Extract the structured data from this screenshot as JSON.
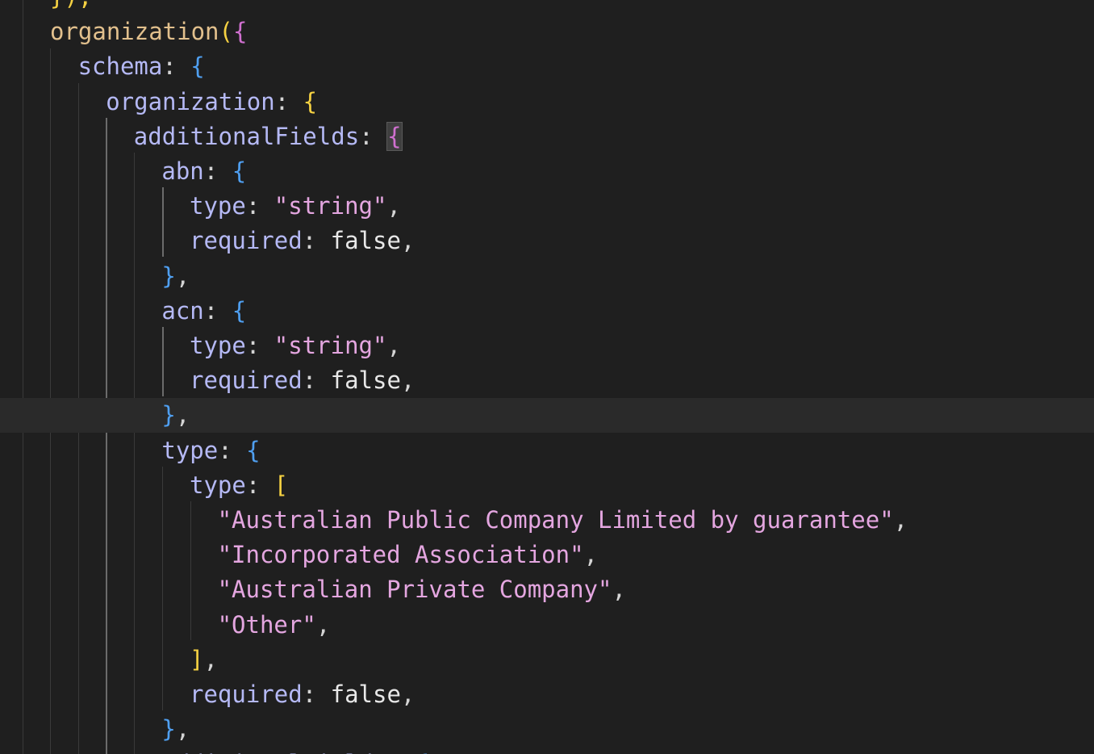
{
  "editor": {
    "lines": [
      {
        "tokens": [
          {
            "t": "});",
            "c": "b-yellow"
          }
        ]
      },
      {
        "tokens": [
          {
            "t": "organization",
            "c": "func"
          },
          {
            "t": "(",
            "c": "b-yellow"
          },
          {
            "t": "{",
            "c": "b-pink"
          }
        ]
      },
      {
        "tokens": [
          {
            "t": "schema",
            "c": "prop"
          },
          {
            "t": ": ",
            "c": "pun"
          },
          {
            "t": "{",
            "c": "b-blue"
          }
        ]
      },
      {
        "tokens": [
          {
            "t": "organization",
            "c": "prop"
          },
          {
            "t": ": ",
            "c": "pun"
          },
          {
            "t": "{",
            "c": "b-yellow"
          }
        ]
      },
      {
        "tokens": [
          {
            "t": "additionalFields",
            "c": "prop"
          },
          {
            "t": ": ",
            "c": "pun"
          },
          {
            "t": "{",
            "c": "b-pink b-hl"
          }
        ]
      },
      {
        "tokens": [
          {
            "t": "abn",
            "c": "prop"
          },
          {
            "t": ": ",
            "c": "pun"
          },
          {
            "t": "{",
            "c": "b-blue"
          }
        ]
      },
      {
        "tokens": [
          {
            "t": "type",
            "c": "prop"
          },
          {
            "t": ": ",
            "c": "pun"
          },
          {
            "t": "\"string\"",
            "c": "str"
          },
          {
            "t": ",",
            "c": "pun"
          }
        ]
      },
      {
        "tokens": [
          {
            "t": "required",
            "c": "prop"
          },
          {
            "t": ": ",
            "c": "pun"
          },
          {
            "t": "false",
            "c": "kw"
          },
          {
            "t": ",",
            "c": "pun"
          }
        ]
      },
      {
        "tokens": [
          {
            "t": "}",
            "c": "b-blue"
          },
          {
            "t": ",",
            "c": "pun"
          }
        ]
      },
      {
        "tokens": [
          {
            "t": "acn",
            "c": "prop"
          },
          {
            "t": ": ",
            "c": "pun"
          },
          {
            "t": "{",
            "c": "b-blue"
          }
        ]
      },
      {
        "tokens": [
          {
            "t": "type",
            "c": "prop"
          },
          {
            "t": ": ",
            "c": "pun"
          },
          {
            "t": "\"string\"",
            "c": "str"
          },
          {
            "t": ",",
            "c": "pun"
          }
        ]
      },
      {
        "tokens": [
          {
            "t": "required",
            "c": "prop"
          },
          {
            "t": ": ",
            "c": "pun"
          },
          {
            "t": "false",
            "c": "kw"
          },
          {
            "t": ",",
            "c": "pun"
          }
        ]
      },
      {
        "tokens": [
          {
            "t": "}",
            "c": "b-blue"
          },
          {
            "t": ",",
            "c": "pun"
          }
        ]
      },
      {
        "tokens": [
          {
            "t": "type",
            "c": "prop"
          },
          {
            "t": ": ",
            "c": "pun"
          },
          {
            "t": "{",
            "c": "b-blue"
          }
        ]
      },
      {
        "tokens": [
          {
            "t": "type",
            "c": "prop"
          },
          {
            "t": ": ",
            "c": "pun"
          },
          {
            "t": "[",
            "c": "b-yellow"
          }
        ]
      },
      {
        "tokens": [
          {
            "t": "\"Australian Public Company Limited by guarantee\"",
            "c": "str"
          },
          {
            "t": ",",
            "c": "pun"
          }
        ]
      },
      {
        "tokens": [
          {
            "t": "\"Incorporated Association\"",
            "c": "str"
          },
          {
            "t": ",",
            "c": "pun"
          }
        ]
      },
      {
        "tokens": [
          {
            "t": "\"Australian Private Company\"",
            "c": "str"
          },
          {
            "t": ",",
            "c": "pun"
          }
        ]
      },
      {
        "tokens": [
          {
            "t": "\"Other\"",
            "c": "str"
          },
          {
            "t": ",",
            "c": "pun"
          }
        ]
      },
      {
        "tokens": [
          {
            "t": "]",
            "c": "b-yellow"
          },
          {
            "t": ",",
            "c": "pun"
          }
        ]
      },
      {
        "tokens": [
          {
            "t": "required",
            "c": "prop"
          },
          {
            "t": ": ",
            "c": "pun"
          },
          {
            "t": "false",
            "c": "kw"
          },
          {
            "t": ",",
            "c": "pun"
          }
        ]
      },
      {
        "tokens": [
          {
            "t": "}",
            "c": "b-blue"
          },
          {
            "t": ",",
            "c": "pun"
          }
        ]
      },
      {
        "tokens": [
          {
            "t": "additionalFields",
            "c": "prop"
          },
          {
            "t": ": ",
            "c": "pun"
          },
          {
            "t": "{",
            "c": "b-blue"
          }
        ]
      }
    ]
  }
}
